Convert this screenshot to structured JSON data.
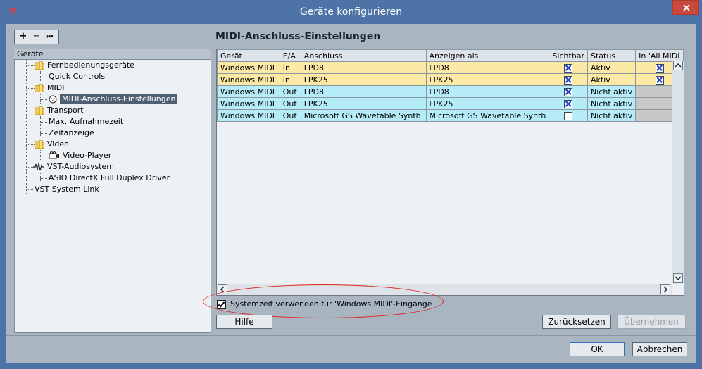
{
  "window": {
    "title": "Geräte konfigurieren"
  },
  "toolbar": {
    "add": "+",
    "remove": "−",
    "reset": "⏮"
  },
  "tree": {
    "header": "Geräte",
    "items": [
      {
        "label": "Fernbedienungsgeräte",
        "type": "folder"
      },
      {
        "label": "Quick Controls",
        "type": "leaf"
      },
      {
        "label": "MIDI",
        "type": "folder"
      },
      {
        "label": "MIDI-Anschluss-Einstellungen",
        "type": "leaf-midi",
        "selected": true
      },
      {
        "label": "Transport",
        "type": "folder"
      },
      {
        "label": "Max. Aufnahmezeit",
        "type": "leaf"
      },
      {
        "label": "Zeitanzeige",
        "type": "leaf"
      },
      {
        "label": "Video",
        "type": "folder"
      },
      {
        "label": "Video-Player",
        "type": "leaf-video"
      },
      {
        "label": "VST-Audiosystem",
        "type": "audio"
      },
      {
        "label": "ASIO DirectX Full Duplex Driver",
        "type": "leaf"
      },
      {
        "label": "VST System Link",
        "type": "root"
      }
    ]
  },
  "panel": {
    "title": "MIDI-Anschluss-Einstellungen",
    "columns": [
      "Gerät",
      "E/A",
      "Anschluss",
      "Anzeigen als",
      "Sichtbar",
      "Status",
      "In 'All MIDI"
    ],
    "rows": [
      {
        "kind": "in",
        "geraet": "Windows MIDI",
        "ea": "In",
        "anschluss": "LPD8",
        "anzeigen": "LPD8",
        "sichtbar": true,
        "status": "Aktiv",
        "allmidi": true
      },
      {
        "kind": "in",
        "geraet": "Windows MIDI",
        "ea": "In",
        "anschluss": "LPK25",
        "anzeigen": "LPK25",
        "sichtbar": true,
        "status": "Aktiv",
        "allmidi": true
      },
      {
        "kind": "out",
        "geraet": "Windows MIDI",
        "ea": "Out",
        "anschluss": "LPD8",
        "anzeigen": "LPD8",
        "sichtbar": true,
        "status": "Nicht aktiv",
        "allmidi": null
      },
      {
        "kind": "out",
        "geraet": "Windows MIDI",
        "ea": "Out",
        "anschluss": "LPK25",
        "anzeigen": "LPK25",
        "sichtbar": true,
        "status": "Nicht aktiv",
        "allmidi": null
      },
      {
        "kind": "out",
        "geraet": "Windows MIDI",
        "ea": "Out",
        "anschluss": "Microsoft GS Wavetable Synth",
        "anzeigen": "Microsoft GS Wavetable Synth",
        "sichtbar": false,
        "status": "Nicht aktiv",
        "allmidi": null
      }
    ],
    "systime_label": "Systemzeit verwenden für 'Windows MIDI'-Eingänge",
    "systime_checked": true,
    "help": "Hilfe",
    "reset": "Zurücksetzen",
    "apply": "Übernehmen"
  },
  "footer": {
    "ok": "OK",
    "cancel": "Abbrechen"
  },
  "colors": {
    "row_in": "#fde9a6",
    "row_out": "#b5ecf7",
    "annotation": "#e0251d",
    "frame": "#4e73a6"
  }
}
